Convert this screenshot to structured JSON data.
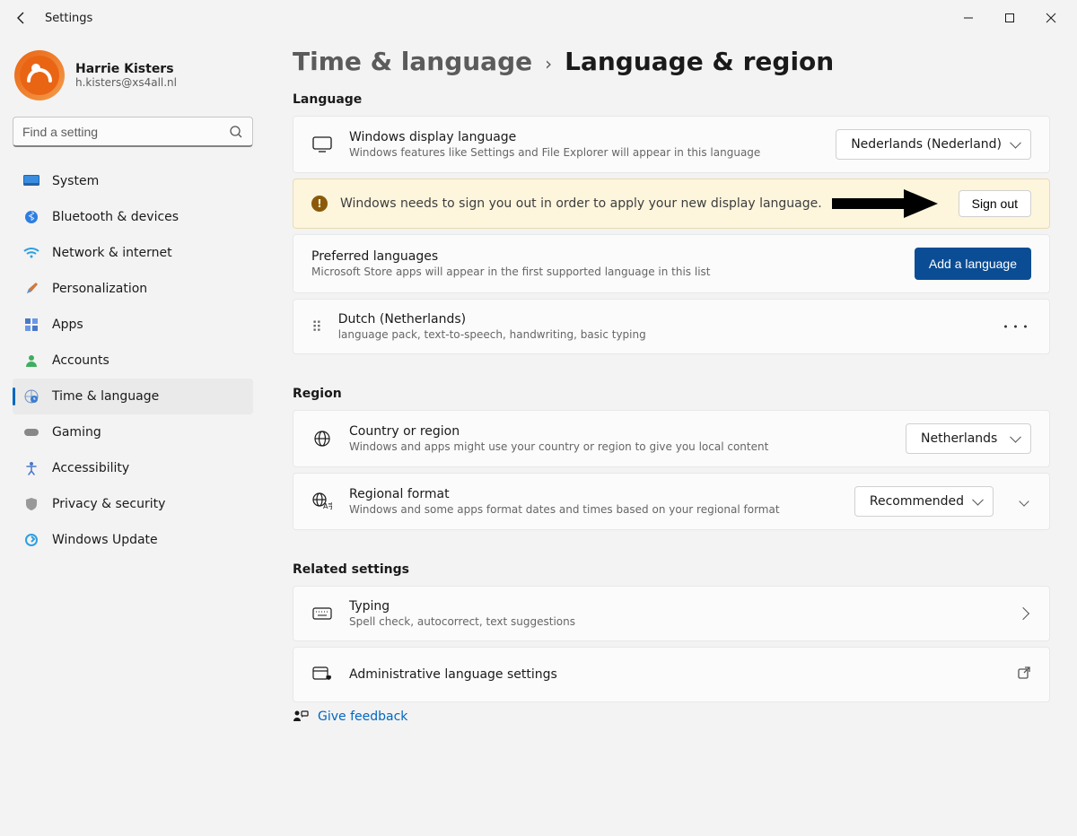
{
  "titlebar": {
    "title": "Settings"
  },
  "user": {
    "name": "Harrie Kisters",
    "email": "h.kisters@xs4all.nl"
  },
  "search": {
    "placeholder": "Find a setting"
  },
  "nav": {
    "items": [
      {
        "label": "System"
      },
      {
        "label": "Bluetooth & devices"
      },
      {
        "label": "Network & internet"
      },
      {
        "label": "Personalization"
      },
      {
        "label": "Apps"
      },
      {
        "label": "Accounts"
      },
      {
        "label": "Time & language"
      },
      {
        "label": "Gaming"
      },
      {
        "label": "Accessibility"
      },
      {
        "label": "Privacy & security"
      },
      {
        "label": "Windows Update"
      }
    ]
  },
  "breadcrumb": {
    "parent": "Time & language",
    "current": "Language & region"
  },
  "sections": {
    "language": {
      "heading": "Language",
      "display": {
        "title": "Windows display language",
        "sub": "Windows features like Settings and File Explorer will appear in this language",
        "value": "Nederlands (Nederland)"
      },
      "alert": {
        "text": "Windows needs to sign you out in order to apply your new display language.",
        "button": "Sign out"
      },
      "preferred": {
        "title": "Preferred languages",
        "sub": "Microsoft Store apps will appear in the first supported language in this list",
        "button": "Add a language"
      },
      "lang_item": {
        "title": "Dutch (Netherlands)",
        "sub": "language pack, text-to-speech, handwriting, basic typing"
      }
    },
    "region": {
      "heading": "Region",
      "country": {
        "title": "Country or region",
        "sub": "Windows and apps might use your country or region to give you local content",
        "value": "Netherlands"
      },
      "format": {
        "title": "Regional format",
        "sub": "Windows and some apps format dates and times based on your regional format",
        "value": "Recommended"
      }
    },
    "related": {
      "heading": "Related settings",
      "typing": {
        "title": "Typing",
        "sub": "Spell check, autocorrect, text suggestions"
      },
      "admin": {
        "title": "Administrative language settings"
      }
    },
    "feedback": {
      "label": "Give feedback"
    }
  }
}
